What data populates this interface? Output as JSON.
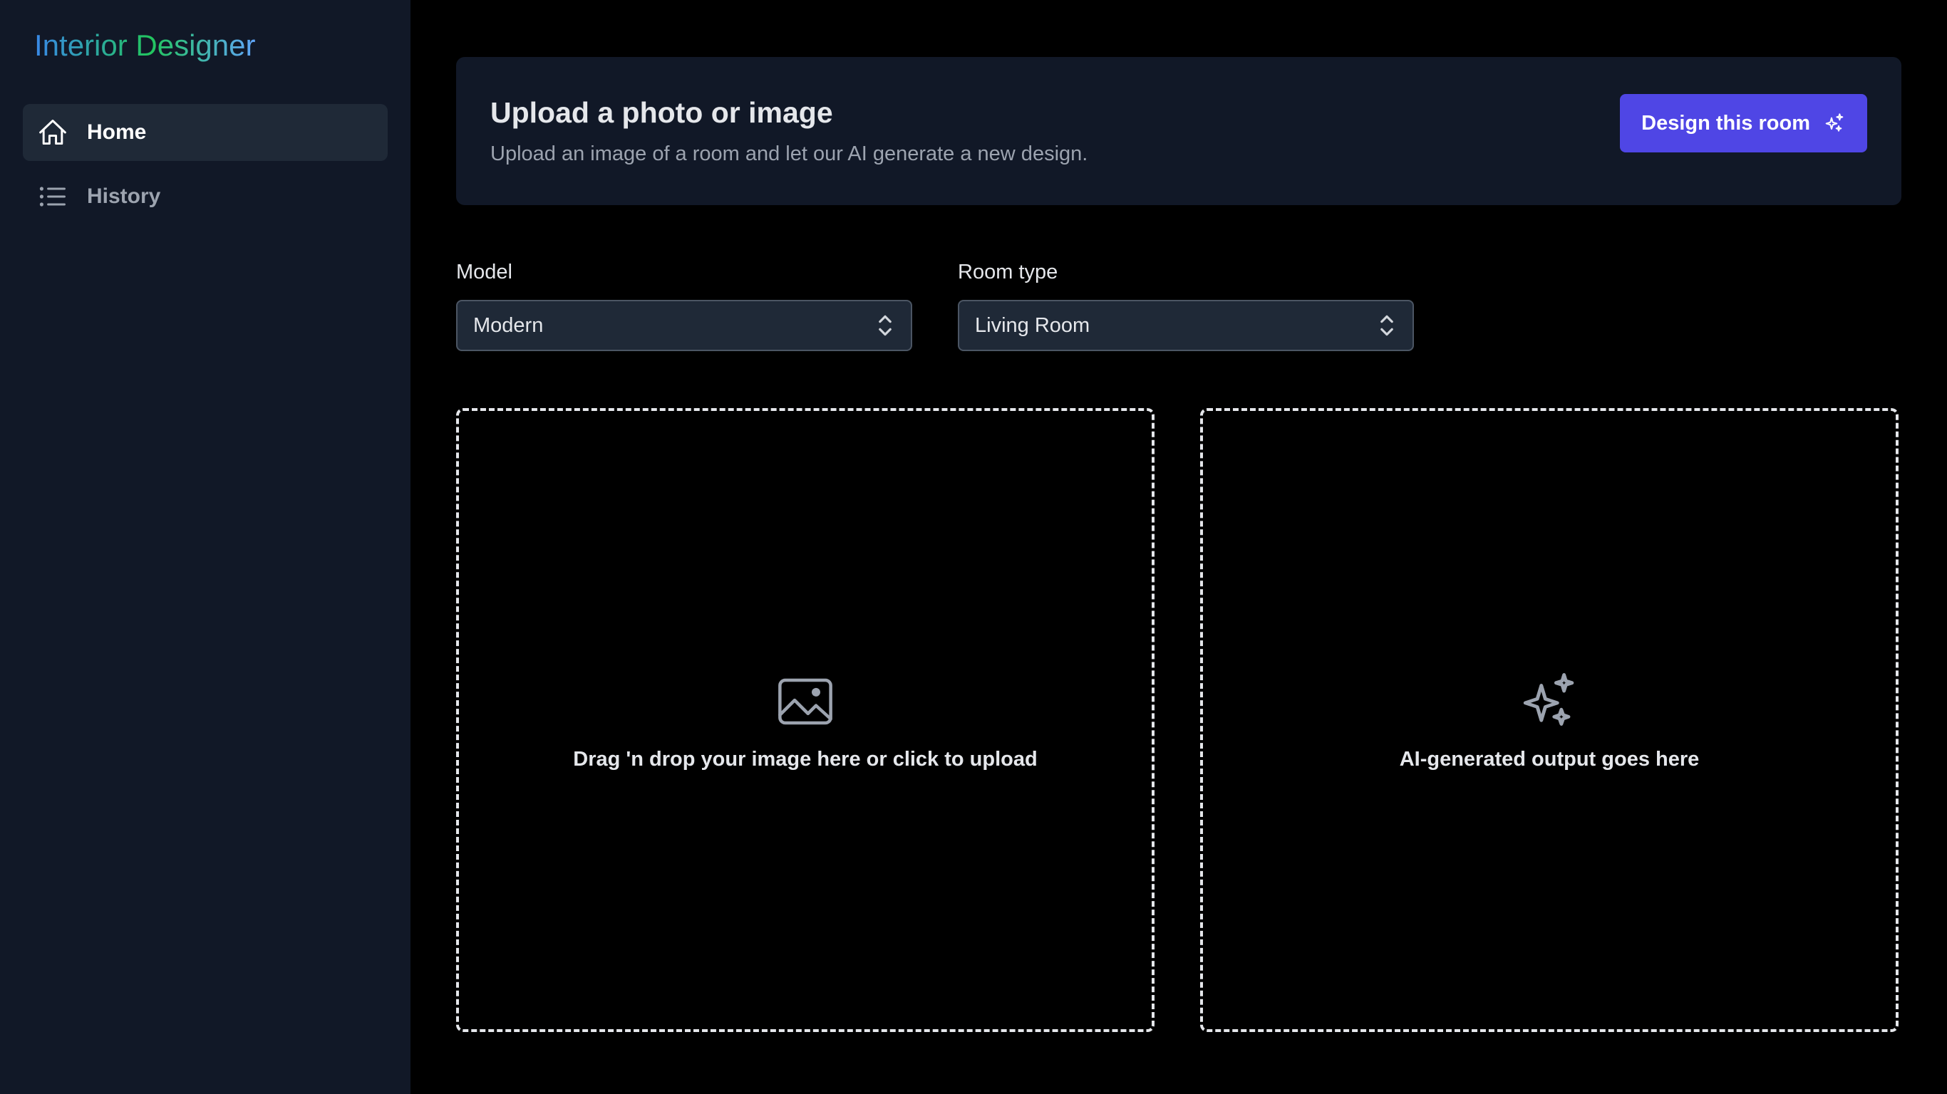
{
  "app": {
    "title": "Interior Designer"
  },
  "sidebar": {
    "items": [
      {
        "label": "Home",
        "icon": "home-icon",
        "active": true
      },
      {
        "label": "History",
        "icon": "list-icon",
        "active": false
      }
    ]
  },
  "upload_card": {
    "title": "Upload a photo or image",
    "subtitle": "Upload an image of a room and let our AI generate a new design.",
    "button_label": "Design this room"
  },
  "fields": {
    "model": {
      "label": "Model",
      "value": "Modern"
    },
    "room_type": {
      "label": "Room type",
      "value": "Living Room"
    }
  },
  "dropzones": {
    "input": {
      "text": "Drag 'n drop your image here or click to upload",
      "icon": "image-icon"
    },
    "output": {
      "text": "AI-generated output goes here",
      "icon": "sparkles-icon"
    }
  },
  "colors": {
    "sidebar_bg": "#111827",
    "main_bg": "#000000",
    "card_bg": "#111827",
    "accent": "#4f46e5",
    "select_bg": "#1f2937"
  }
}
